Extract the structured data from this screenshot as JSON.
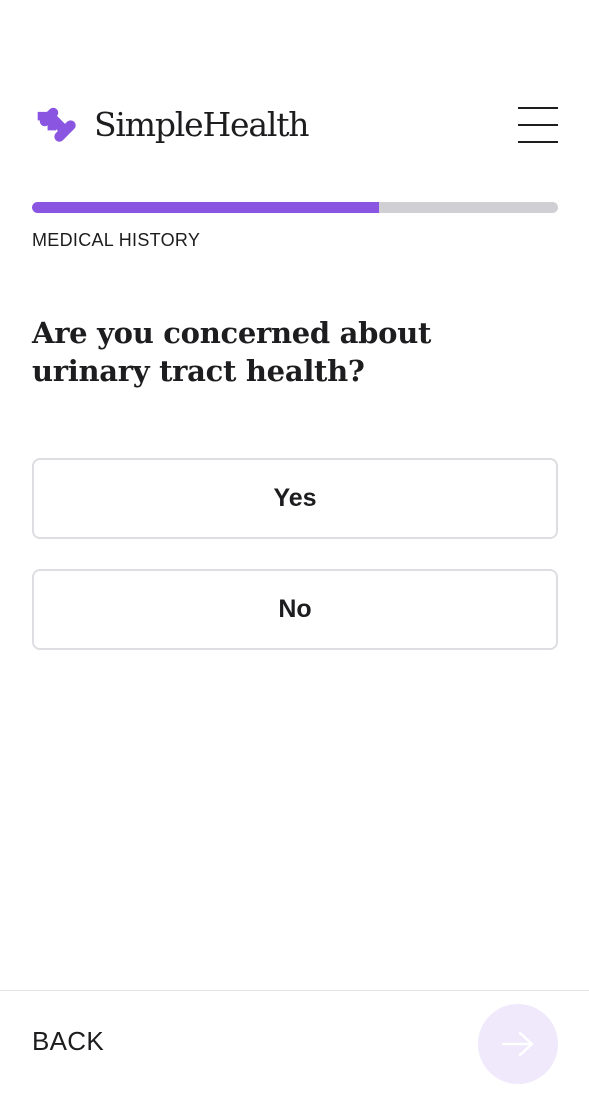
{
  "brand": {
    "name": "SimpleHealth",
    "logo_icon": "chain-link-icon",
    "accent_color": "#8a55e0"
  },
  "header": {
    "menu_icon": "hamburger-menu-icon"
  },
  "progress": {
    "fraction": 0.66,
    "fill_color": "#8a55e0",
    "track_color": "#cfcfd4"
  },
  "section": {
    "label": "MEDICAL HISTORY"
  },
  "question": {
    "text": "Are you concerned about urinary tract health?"
  },
  "options": [
    {
      "label": "Yes"
    },
    {
      "label": "No"
    }
  ],
  "footer": {
    "back_label": "BACK",
    "next_icon": "arrow-right-icon",
    "next_disabled": true
  }
}
